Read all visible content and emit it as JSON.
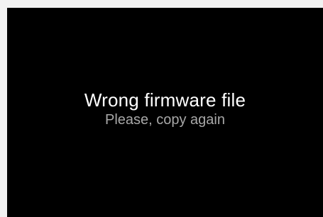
{
  "dialog": {
    "title": "Wrong firmware file",
    "subtitle": "Please, copy again"
  },
  "colors": {
    "outer_background": "#f2f2f2",
    "screen_background": "#000000",
    "title_text": "#ffffff",
    "subtitle_text": "#a8a8a8"
  }
}
